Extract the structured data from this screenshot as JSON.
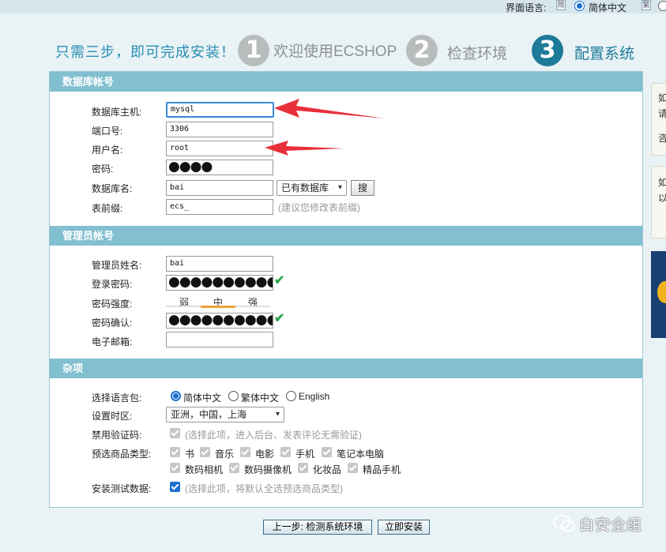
{
  "topbar": {
    "language_label": "界面语言:",
    "language_selected": "简体中文"
  },
  "header": {
    "slogan": "只需三步，即可完成安装！",
    "steps": [
      {
        "number": "1",
        "label": "欢迎使用ECSHOP"
      },
      {
        "number": "2",
        "label": "检查环境"
      },
      {
        "number": "3",
        "label": "配置系统"
      }
    ]
  },
  "database": {
    "title": "数据库帐号",
    "host_label": "数据库主机:",
    "host_value": "mysql",
    "port_label": "端口号:",
    "port_value": "3306",
    "user_label": "用户名:",
    "user_value": "root",
    "password_label": "密码:",
    "password_mask": "●●●●",
    "dbname_label": "数据库名:",
    "dbname_value": "bai",
    "existing_db_select": "已有数据库",
    "search_button": "搜",
    "prefix_label": "表前缀:",
    "prefix_value": "ecs_",
    "prefix_hint": "(建议您修改表前缀)"
  },
  "admin": {
    "title": "管理员帐号",
    "name_label": "管理员姓名:",
    "name_value": "bai",
    "password_label": "登录密码:",
    "password_mask": "●●●●●●●●●●●●",
    "strength_label": "密码强度:",
    "strength_weak": "弱",
    "strength_mid": "中",
    "strength_strong": "强",
    "strength_level": "中",
    "confirm_label": "密码确认:",
    "confirm_mask": "●●●●●●●●●●●●",
    "email_label": "电子邮箱:",
    "email_value": ""
  },
  "misc": {
    "title": "杂项",
    "langpack_label": "选择语言包:",
    "langpack_options": [
      "简体中文",
      "繁体中文",
      "English"
    ],
    "langpack_selected": "简体中文",
    "timezone_label": "设置时区:",
    "timezone_value": "亚洲，中国，上海",
    "captcha_label": "禁用验证码:",
    "captcha_hint": "(选择此项，进入后台、发表评论无需验证)",
    "goods_type_label": "预选商品类型:",
    "goods_types_row1": [
      "书",
      "音乐",
      "电影",
      "手机",
      "笔记本电脑"
    ],
    "goods_types_row2": [
      "数码相机",
      "数码摄像机",
      "化妆品",
      "精品手机"
    ],
    "test_data_label": "安装测试数据:",
    "test_data_hint": "(选择此项，将默认全选预选商品类型)"
  },
  "buttons": {
    "prev": "上一步: 检测系统环境",
    "install": "立即安装"
  },
  "side": {
    "card1_line1": "如",
    "card1_line2": "请",
    "card1_line3": "咨",
    "card2_line1": "如",
    "card2_line2": "以"
  },
  "watermark": "白安全组",
  "colors": {
    "section_header": "#82bfd0",
    "step_active": "#1d7a99",
    "step_inactive": "#b9bcbd",
    "annotation_arrow": "#e8303a",
    "valid_check": "#2ea44f"
  }
}
